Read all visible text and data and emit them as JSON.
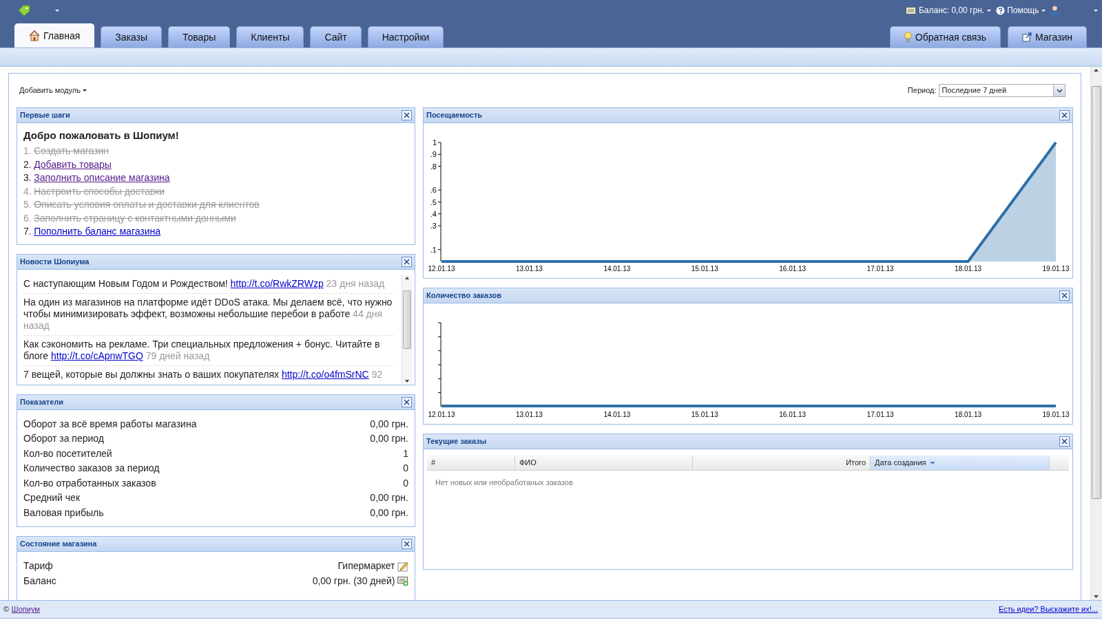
{
  "top_bar": {
    "balance": "Баланс: 0,00 грн.",
    "help": "Помощь"
  },
  "tabs": [
    {
      "label": "Главная",
      "selected": true,
      "kind": "home"
    },
    {
      "label": "Заказы",
      "selected": false,
      "kind": "plain"
    },
    {
      "label": "Товары",
      "selected": false,
      "kind": "plain"
    },
    {
      "label": "Клиенты",
      "selected": false,
      "kind": "plain"
    },
    {
      "label": "Сайт",
      "selected": false,
      "kind": "plain"
    },
    {
      "label": "Настройки",
      "selected": false,
      "kind": "plain"
    }
  ],
  "right_tabs": [
    {
      "label": "Обратная связь",
      "kind": "feedback"
    },
    {
      "label": "Магазин",
      "kind": "store"
    }
  ],
  "toolbar": {
    "add_module": "Добавить модуль",
    "period_label": "Период:",
    "period_value": "Последние 7 дней"
  },
  "first_steps": {
    "title": "Первые шаги",
    "heading": "Добро пожаловать в Шопиум!",
    "steps": [
      {
        "number": "1.",
        "text": "Создать магазин",
        "done": true
      },
      {
        "number": "2.",
        "text": "Добавить товары",
        "done": false,
        "visited": true
      },
      {
        "number": "3.",
        "text": "Заполнить описание магазина",
        "done": false,
        "visited": true
      },
      {
        "number": "4.",
        "text": "Настроить способы доставки",
        "done": true
      },
      {
        "number": "5.",
        "text": "Описать условия оплаты и доставки для клиентов",
        "done": true
      },
      {
        "number": "6.",
        "text": "Заполнить страницу с контактными данными",
        "done": true
      },
      {
        "number": "7.",
        "text": "Пополнить баланс магазина",
        "done": false,
        "visited": false
      }
    ]
  },
  "news": {
    "title": "Новости Шопиума",
    "items": [
      {
        "text": "С наступающим Новым Годом и Рождеством!",
        "link": "http://t.co/RwkZRWzp",
        "time": "23 дня назад"
      },
      {
        "text": "На один из магазинов на платформе идёт DDoS атака. Мы делаем всё, что нужно чтобы минимизировать эффект, возможны небольшие перебои в работе",
        "time": "44 дня назад"
      },
      {
        "text": "Как сэкономить на рекламе. Три специальных предложения + бонус. Читайте в блоге",
        "link": "http://t.co/cApnwTGQ",
        "time": "79 дней назад"
      },
      {
        "text": "7 вещей, которые вы должны знать о ваших покупателях",
        "link": "http://t.co/o4fmSrNC",
        "time": "92"
      }
    ]
  },
  "indicators": {
    "title": "Показатели",
    "rows": [
      {
        "label": "Оборот за всё время работы магазина",
        "value": "0,00 грн."
      },
      {
        "label": "Оборот за период",
        "value": "0,00 грн."
      },
      {
        "label": "Кол-во посетителей",
        "value": "1"
      },
      {
        "label": "Количество заказов за период",
        "value": "0"
      },
      {
        "label": "Кол-во отработанных заказов",
        "value": "0"
      },
      {
        "label": "Средний чек",
        "value": "0,00 грн."
      },
      {
        "label": "Валовая прибыль",
        "value": "0,00 грн."
      }
    ]
  },
  "store_status": {
    "title": "Состояние магазина",
    "rows": [
      {
        "label": "Тариф",
        "value": "Гипермаркет",
        "kind": "edit"
      },
      {
        "label": "Баланс",
        "value": "0,00 грн. (30 дней)",
        "kind": "topup"
      }
    ]
  },
  "visits": {
    "title": "Посещаемость",
    "chart_data": {
      "type": "area",
      "categories": [
        "12.01.13",
        "13.01.13",
        "14.01.13",
        "15.01.13",
        "16.01.13",
        "17.01.13",
        "18.01.13",
        "19.01.13"
      ],
      "series": [
        {
          "color": "#2e6fa7",
          "values": [
            0,
            0,
            0,
            0,
            0,
            0,
            0,
            1
          ]
        }
      ],
      "ylim": [
        0,
        1
      ],
      "yticks": [
        {
          "value": 0.1,
          "label": ".1"
        },
        {
          "value": 0.3,
          "label": ".3"
        },
        {
          "value": 0.4,
          "label": ".4"
        },
        {
          "value": 0.5,
          "label": ".5"
        },
        {
          "value": 0.6,
          "label": ".6"
        },
        {
          "value": 0.8,
          "label": ".8"
        },
        {
          "value": 0.9,
          "label": ".9"
        },
        {
          "value": 1,
          "label": "1"
        }
      ]
    }
  },
  "orders_count": {
    "title": "Количество заказов",
    "date_labels": [
      "12.01.13",
      "13.01.13",
      "14.01.13",
      "15.01.13",
      "16.01.13",
      "17.01.13",
      "18.01.13",
      "19.01.13"
    ]
  },
  "current_orders": {
    "title": "Текущие заказы",
    "columns": [
      {
        "label": "#",
        "sorted": false
      },
      {
        "label": "ФИО",
        "sorted": false
      },
      {
        "label": "Итого",
        "sorted": false
      },
      {
        "label": "Дата создания",
        "sorted": true
      }
    ],
    "empty_text": "Нет новых или необработаных заказов"
  },
  "footer": {
    "copyright": "©",
    "link": "Шопиум",
    "feedback_link": "Есть идеи? Выскажите их!..."
  }
}
